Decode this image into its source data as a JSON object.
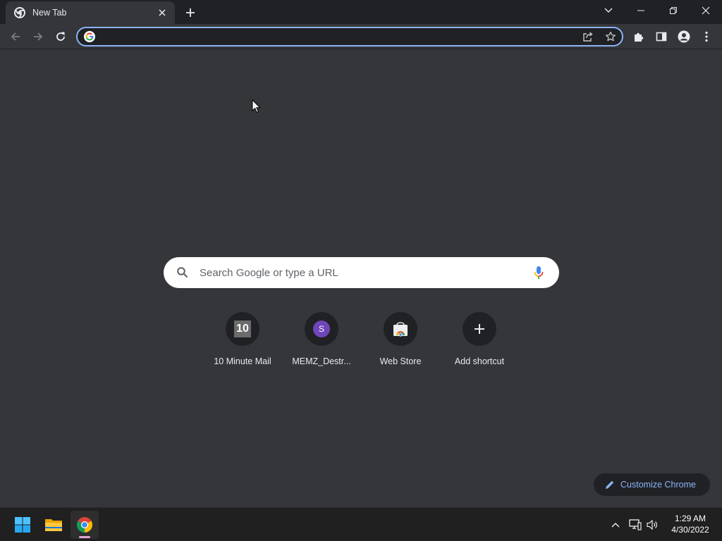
{
  "browser": {
    "tab": {
      "title": "New Tab"
    },
    "omnibox": {
      "value": "",
      "placeholder": ""
    }
  },
  "ntp": {
    "search": {
      "placeholder": "Search Google or type a URL"
    },
    "shortcuts": [
      {
        "label": "10 Minute Mail",
        "icon_text": "10"
      },
      {
        "label": "MEMZ_Destr...",
        "icon_text": "S"
      },
      {
        "label": "Web Store"
      },
      {
        "label": "Add shortcut"
      }
    ],
    "customize_label": "Customize Chrome"
  },
  "taskbar": {
    "time": "1:29 AM",
    "date": "4/30/2022"
  },
  "colors": {
    "accent": "#8ab4f8",
    "background": "#35363a",
    "frame": "#202124",
    "taskbar": "#202020"
  }
}
